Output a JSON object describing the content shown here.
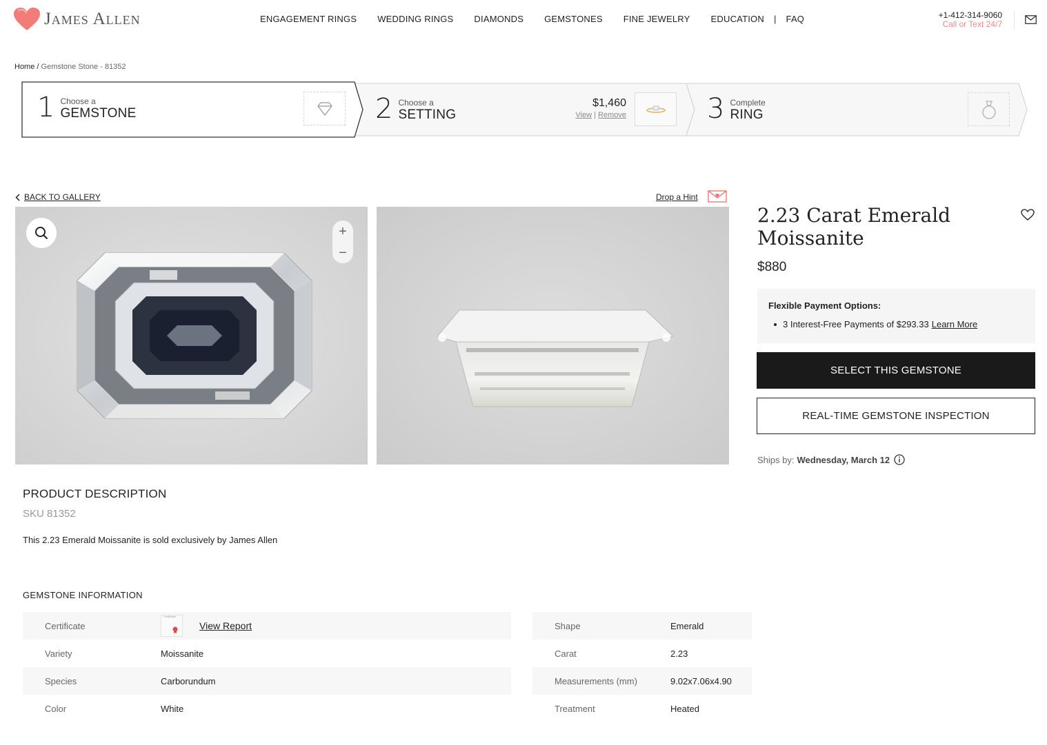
{
  "brand": {
    "name": "James Allen",
    "accent": "#f26c6c"
  },
  "nav": [
    "ENGAGEMENT RINGS",
    "WEDDING RINGS",
    "DIAMONDS",
    "GEMSTONES",
    "FINE JEWELRY",
    "EDUCATION",
    "|",
    "FAQ"
  ],
  "contact": {
    "phone": "+1-412-314-9060",
    "note": "Call or Text 24/7"
  },
  "breadcrumb": {
    "home": "Home",
    "sep": "/",
    "current": "Gemstone Stone - 81352"
  },
  "steps": [
    {
      "num": "1",
      "small": "Choose a",
      "big": "GEMSTONE"
    },
    {
      "num": "2",
      "small": "Choose a",
      "big": "SETTING",
      "price": "$1,460",
      "view": "View",
      "divider": "|",
      "remove": "Remove"
    },
    {
      "num": "3",
      "small": "Complete",
      "big": "RING"
    }
  ],
  "gallery": {
    "back": "BACK TO GALLERY",
    "hint": "Drop a Hint",
    "zoom_in": "+",
    "zoom_out": "−"
  },
  "product": {
    "title": "2.23 Carat Emerald Moissanite",
    "price": "$880",
    "payment_heading": "Flexible Payment Options:",
    "payment_text": "3 Interest-Free Payments of $293.33",
    "payment_link": "Learn More",
    "select_label": "SELECT THIS GEMSTONE",
    "inspect_label": "REAL-TIME GEMSTONE INSPECTION",
    "ships_label": "Ships by:",
    "ships_date": "Wednesday, March 12"
  },
  "description": {
    "heading": "PRODUCT DESCRIPTION",
    "sku": "SKU 81352",
    "text": "This 2.23 Emerald Moissanite is sold exclusively by James Allen"
  },
  "info": {
    "heading": "GEMSTONE INFORMATION",
    "certificate_label": "Certificate",
    "certificate_thumb_text": "Certificate",
    "certificate_link": "View Report",
    "left": [
      {
        "k": "Variety",
        "v": "Moissanite"
      },
      {
        "k": "Species",
        "v": "Carborundum"
      },
      {
        "k": "Color",
        "v": "White"
      }
    ],
    "right": [
      {
        "k": "Shape",
        "v": "Emerald"
      },
      {
        "k": "Carat",
        "v": "2.23"
      },
      {
        "k": "Measurements (mm)",
        "v": "9.02x7.06x4.90"
      },
      {
        "k": "Treatment",
        "v": "Heated"
      }
    ]
  }
}
